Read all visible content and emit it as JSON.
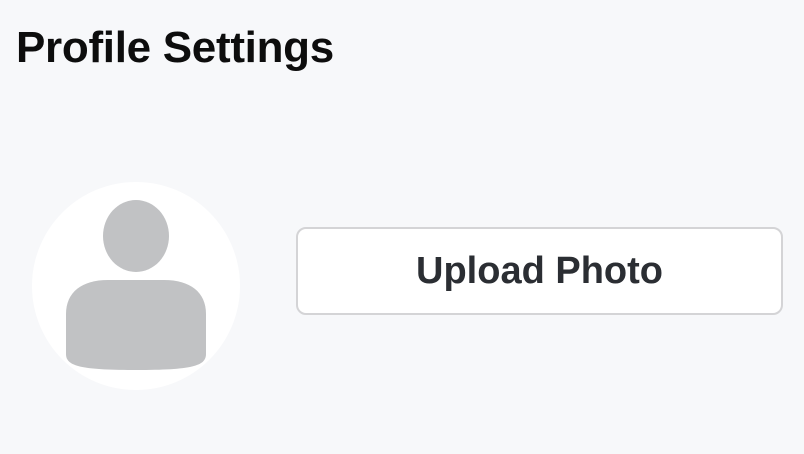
{
  "page": {
    "title": "Profile Settings"
  },
  "avatar": {
    "icon": "person-placeholder-icon"
  },
  "actions": {
    "upload_label": "Upload Photo"
  },
  "colors": {
    "background": "#f7f8fa",
    "avatar_background": "#ffffff",
    "placeholder_gray": "#c1c2c4",
    "button_border": "#d4d4d6",
    "button_text": "#2b2e33",
    "title_text": "#0d0d0d"
  }
}
